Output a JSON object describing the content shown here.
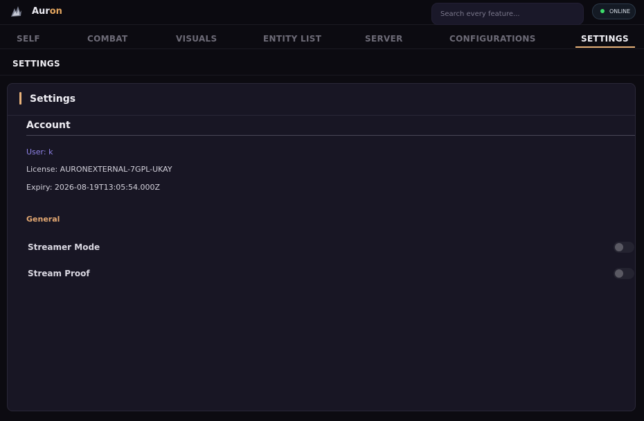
{
  "app": {
    "brand_main": "Aur",
    "brand_accent": "on",
    "search_placeholder": "Search every feature...",
    "status": "ONLINE",
    "status_color": "#3ddc6a",
    "accent_color": "#e9b37a"
  },
  "tabs": [
    {
      "label": "SELF",
      "active": false
    },
    {
      "label": "COMBAT",
      "active": false
    },
    {
      "label": "VISUALS",
      "active": false
    },
    {
      "label": "ENTITY LIST",
      "active": false
    },
    {
      "label": "SERVER",
      "active": false
    },
    {
      "label": "CONFIGURATIONS",
      "active": false
    },
    {
      "label": "SETTINGS",
      "active": true
    }
  ],
  "subheader": "SETTINGS",
  "panel": {
    "title": "Settings",
    "account": {
      "title": "Account",
      "user": "User: k",
      "license": "License: AURONEXTERNAL-7GPL-UKAY",
      "expiry": "Expiry: 2026-08-19T13:05:54.000Z"
    },
    "general": {
      "title": "General",
      "options": [
        {
          "label": "Streamer Mode",
          "enabled": false
        },
        {
          "label": "Stream Proof",
          "enabled": false
        }
      ]
    }
  }
}
